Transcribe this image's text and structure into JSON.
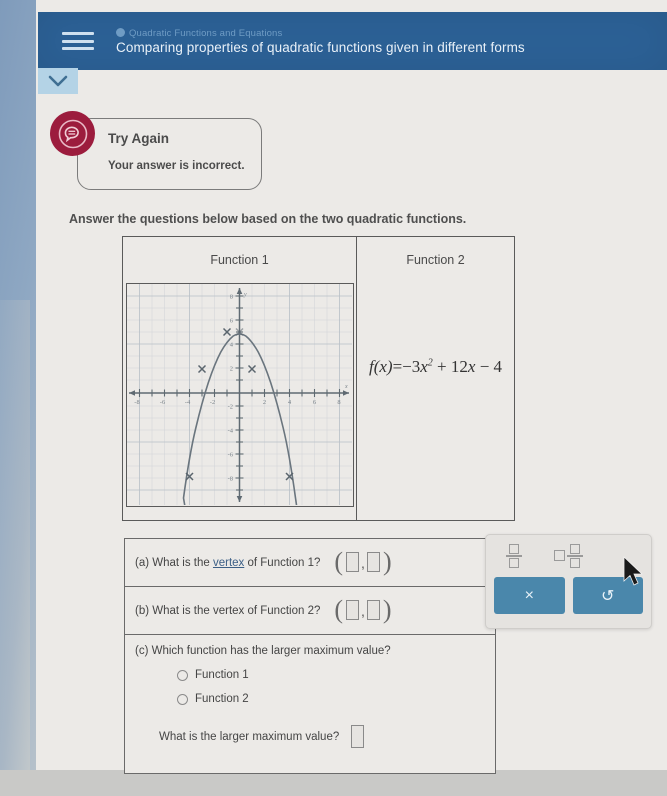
{
  "header": {
    "eyebrow": "Quadratic Functions and Equations",
    "title": "Comparing properties of quadratic functions given in different forms",
    "menu_icon": "hamburger-icon",
    "expand_icon": "chevron-down-icon",
    "bg_color": "#2c6196"
  },
  "feedback": {
    "title": "Try Again",
    "message": "Your answer is incorrect.",
    "badge_icon": "speech-bubble-icon",
    "badge_color": "#9c1c3d"
  },
  "instruction": "Answer the questions below based on the two quadratic functions.",
  "function_table": {
    "col1_header": "Function 1",
    "col2_header": "Function 2",
    "function2_equation": "f(x) = -3x^2 + 12x - 4",
    "function2_parts": {
      "lhs": "f(x)",
      "eq": "=",
      "term1_coef": "−3",
      "term1_var": "x",
      "term1_exp": "2",
      "term2": "+ 12",
      "term2_var": "x",
      "term3": "− 4"
    }
  },
  "chart_data": {
    "type": "line",
    "title": "Function 1",
    "xlabel": "x",
    "ylabel": "y",
    "xlim": [
      -9,
      9
    ],
    "ylim": [
      -9,
      9
    ],
    "grid": true,
    "xticks": [
      -8,
      -6,
      -4,
      -2,
      2,
      4,
      6,
      8
    ],
    "xtick_labels": [
      "-8",
      "-6",
      "-4",
      "-2",
      "2",
      "4",
      "6",
      "8"
    ],
    "yticks": [
      -8,
      -6,
      -4,
      -2,
      2,
      4,
      6,
      8
    ],
    "ytick_labels": [
      "-8",
      "-6",
      "-4",
      "-2",
      "2",
      "4",
      "6",
      "8"
    ],
    "curve": "downward parabola, vertex (-1, 5)",
    "vertex": [
      -1,
      5
    ],
    "equation": "y = -(4/3)(x+1)^2 + 5",
    "marked_points": [
      [
        -1,
        5
      ],
      [
        -3,
        2
      ],
      [
        1,
        2
      ],
      [
        -4,
        -7
      ],
      [
        2,
        -7
      ]
    ],
    "x": [
      -4.6,
      -4.0,
      -3.0,
      -2.0,
      -1.0,
      0.0,
      1.0,
      2.0,
      2.6
    ],
    "y": [
      -12.3,
      -7.0,
      0.7,
      3.7,
      5.0,
      3.7,
      0.7,
      -7.0,
      -12.3
    ]
  },
  "questions": {
    "a": {
      "prefix": "(a) What is the ",
      "link": "vertex",
      "suffix": " of Function 1?",
      "answer_x": "",
      "answer_y": ""
    },
    "b": {
      "text": "(b) What is the vertex of Function 2?",
      "answer_x": "",
      "answer_y": ""
    },
    "c": {
      "text": "(c) Which function has the larger maximum value?",
      "options": [
        "Function 1",
        "Function 2"
      ],
      "selected": "",
      "followup": "What is the larger maximum value?",
      "followup_answer": ""
    }
  },
  "keypad": {
    "fraction_icon": "fraction-icon",
    "mixed_number_icon": "mixed-number-icon",
    "clear_label": "×",
    "undo_label": "↺",
    "button_color": "#4a87ab"
  }
}
